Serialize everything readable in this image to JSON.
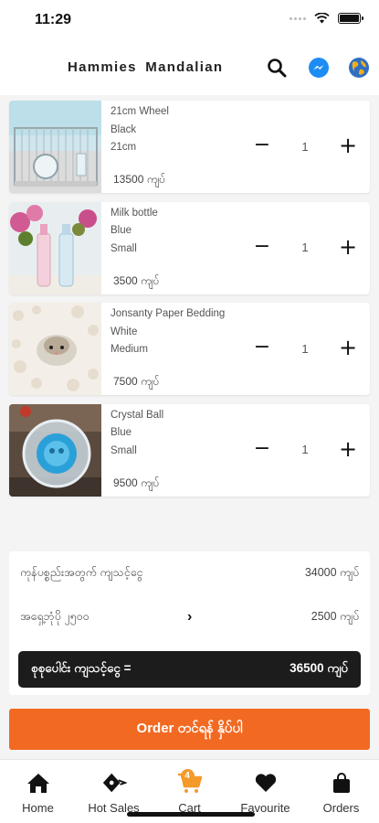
{
  "status_bar": {
    "time": "11:29"
  },
  "header": {
    "title": "Hammies  Mandalian"
  },
  "cart_items": [
    {
      "name": "21cm Wheel",
      "color": "Black",
      "size": "21cm",
      "quantity": "1",
      "price": "13500 ကျပ်"
    },
    {
      "name": "Milk bottle",
      "color": "Blue",
      "size": "Small",
      "quantity": "1",
      "price": "3500 ကျပ်"
    },
    {
      "name": "Jonsanty Paper Bedding",
      "color": "White",
      "size": "Medium",
      "quantity": "1",
      "price": "7500 ကျပ်"
    },
    {
      "name": "Crystal Ball",
      "color": "Blue",
      "size": "Small",
      "quantity": "1",
      "price": "9500 ကျပ်"
    }
  ],
  "summary": {
    "subtotal_label": "ကုန်ပစ္စည်းအတွက် ကျသင့်ငွေ",
    "subtotal_value": "34000 ကျပ်",
    "delivery_label": "အရှေ့ဘုံပို ၂၅၀၀",
    "delivery_value": "2500 ကျပ်",
    "total_label": "စုစုပေါင်း ကျသင့်ငွေ   =",
    "total_value": "36500 ကျပ်"
  },
  "order_button": {
    "label": "Order တင်ရန် နှိပ်ပါ"
  },
  "bottom_nav": {
    "items": [
      {
        "label": "Home"
      },
      {
        "label": "Hot Sales"
      },
      {
        "label": "Cart",
        "badge": "4"
      },
      {
        "label": "Favourite"
      },
      {
        "label": "Orders"
      }
    ]
  },
  "colors": {
    "accent": "#f26a22",
    "badge": "#f39a2a",
    "total_bar": "#1c1c1c",
    "messenger": "#1e8cf5"
  }
}
